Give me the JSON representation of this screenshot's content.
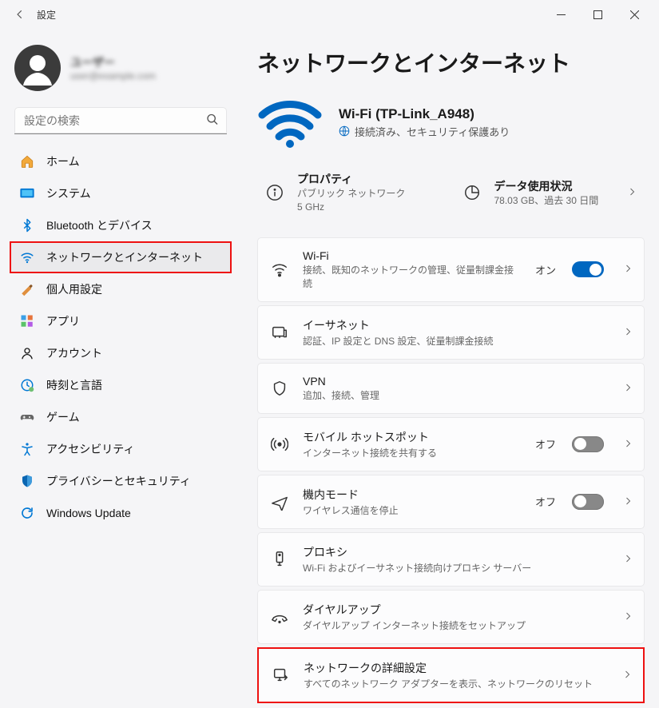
{
  "titlebar": {
    "title": "設定"
  },
  "profile": {
    "name": "ユーザー",
    "email": "user@example.com"
  },
  "search": {
    "placeholder": "設定の検索"
  },
  "sidebar": {
    "items": [
      {
        "icon": "home",
        "label": "ホーム"
      },
      {
        "icon": "system",
        "label": "システム"
      },
      {
        "icon": "bluetooth",
        "label": "Bluetooth とデバイス"
      },
      {
        "icon": "network",
        "label": "ネットワークとインターネット",
        "active": true,
        "highlight": true
      },
      {
        "icon": "personalize",
        "label": "個人用設定"
      },
      {
        "icon": "apps",
        "label": "アプリ"
      },
      {
        "icon": "account",
        "label": "アカウント"
      },
      {
        "icon": "time",
        "label": "時刻と言語"
      },
      {
        "icon": "gaming",
        "label": "ゲーム"
      },
      {
        "icon": "accessibility",
        "label": "アクセシビリティ"
      },
      {
        "icon": "privacy",
        "label": "プライバシーとセキュリティ"
      },
      {
        "icon": "update",
        "label": "Windows Update"
      }
    ]
  },
  "main": {
    "title": "ネットワークとインターネット",
    "status": {
      "ssid": "Wi-Fi (TP-Link_A948)",
      "sub": "接続済み、セキュリティ保護あり"
    },
    "quick": [
      {
        "icon": "info",
        "title": "プロパティ",
        "sub": "パブリック ネットワーク\n5 GHz"
      },
      {
        "icon": "usage",
        "title": "データ使用状況",
        "sub": "78.03 GB、過去 30 日間",
        "chevron": true
      }
    ],
    "tiles": [
      {
        "icon": "wifi",
        "title": "Wi-Fi",
        "sub": "接続、既知のネットワークの管理、従量制課金接続",
        "toggle": {
          "label": "オン",
          "state": "on"
        }
      },
      {
        "icon": "ethernet",
        "title": "イーサネット",
        "sub": "認証、IP 設定と DNS 設定、従量制課金接続"
      },
      {
        "icon": "vpn",
        "title": "VPN",
        "sub": "追加、接続、管理"
      },
      {
        "icon": "hotspot",
        "title": "モバイル ホットスポット",
        "sub": "インターネット接続を共有する",
        "toggle": {
          "label": "オフ",
          "state": "off"
        }
      },
      {
        "icon": "airplane",
        "title": "機内モード",
        "sub": "ワイヤレス通信を停止",
        "toggle": {
          "label": "オフ",
          "state": "off"
        }
      },
      {
        "icon": "proxy",
        "title": "プロキシ",
        "sub": "Wi-Fi およびイーサネット接続向けプロキシ サーバー"
      },
      {
        "icon": "dialup",
        "title": "ダイヤルアップ",
        "sub": "ダイヤルアップ インターネット接続をセットアップ"
      },
      {
        "icon": "advanced",
        "title": "ネットワークの詳細設定",
        "sub": "すべてのネットワーク アダプターを表示、ネットワークのリセット",
        "highlight": true
      }
    ]
  }
}
